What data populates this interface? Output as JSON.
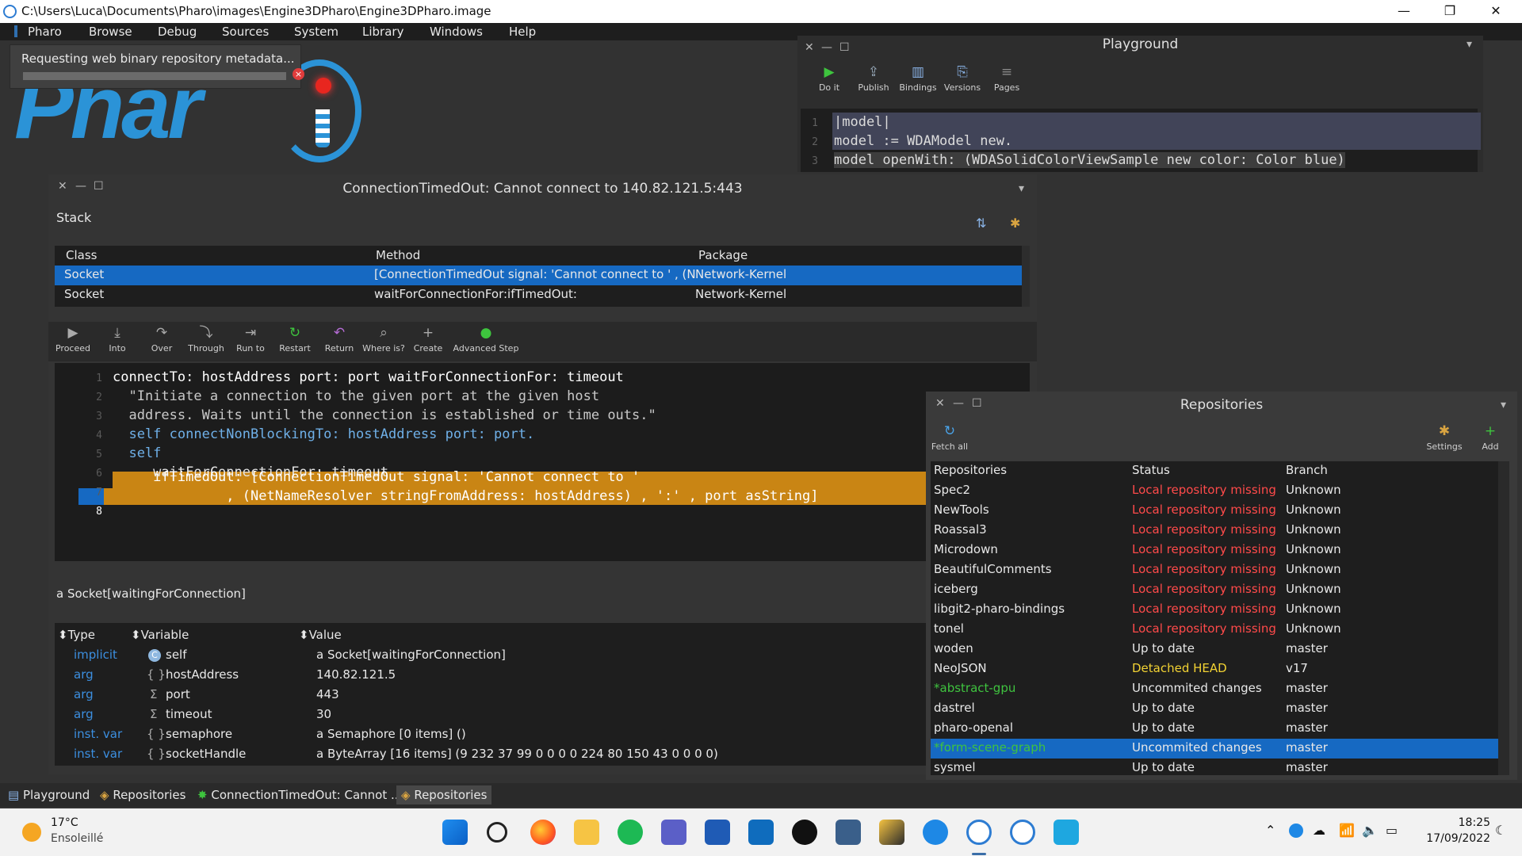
{
  "os_title": "C:\\Users\\Luca\\Documents\\Pharo\\images\\Engine3DPharo\\Engine3DPharo.image",
  "window_controls": {
    "minimize": "—",
    "restore": "❐",
    "close": "✕"
  },
  "menu": [
    "Pharo",
    "Browse",
    "Debug",
    "Sources",
    "System",
    "Library",
    "Windows",
    "Help"
  ],
  "logo_text": "Phar",
  "progress": {
    "label": "Requesting web binary repository metadata...",
    "cancel": "×"
  },
  "playground": {
    "title": "Playground",
    "toolbar": [
      "Do it",
      "Publish",
      "Bindings",
      "Versions",
      "Pages"
    ],
    "lines": [
      {
        "n": "1",
        "text": "|model|"
      },
      {
        "n": "2",
        "text": "model := WDAModel new."
      },
      {
        "n": "3",
        "text": "model openWith: (WDASolidColorViewSample new color: Color blue)"
      }
    ]
  },
  "debugger": {
    "title": "ConnectionTimedOut: Cannot connect to 140.82.121.5:443",
    "stack_label": "Stack",
    "columns": [
      "Class",
      "Method",
      "Package"
    ],
    "rows": [
      {
        "class": "Socket",
        "method": "[ConnectionTimedOut signal: 'Cannot connect to '   , (NetN",
        "package": "Network-Kernel",
        "selected": true
      },
      {
        "class": "Socket",
        "method": "waitForConnectionFor:ifTimedOut:",
        "package": "Network-Kernel",
        "selected": false
      }
    ],
    "toolbar": [
      "Proceed",
      "Into",
      "Over",
      "Through",
      "Run to",
      "Restart",
      "Return",
      "Where is?",
      "Create",
      "Advanced Step"
    ],
    "code_lines": [
      {
        "n": "1",
        "text": "connectTo: hostAddress port: port waitForConnectionFor: timeout"
      },
      {
        "n": "2",
        "text": "  \"Initiate a connection to the given port at the given host"
      },
      {
        "n": "3",
        "text": "  address. Waits until the connection is established or time outs.\""
      },
      {
        "n": "4",
        "text": "  self connectNonBlockingTo: hostAddress port: port."
      },
      {
        "n": "5",
        "text": "  self"
      },
      {
        "n": "6",
        "text": "     waitForConnectionFor: timeout"
      },
      {
        "n": "7",
        "text": "     ifTimedOut: [ConnectionTimedOut signal: 'Cannot connect to '"
      },
      {
        "n": "8",
        "text": "              , (NetNameResolver stringFromAddress: hostAddress) , ':' , port asString]"
      }
    ],
    "receiver_label": "a Socket[waitingForConnection]",
    "inspector_columns": [
      "Type",
      "Variable",
      "Value"
    ],
    "inspector_rows": [
      {
        "type": "implicit",
        "icon": "C",
        "variable": "self",
        "value": "a Socket[waitingForConnection]"
      },
      {
        "type": "arg",
        "icon": "{ }",
        "variable": "hostAddress",
        "value": "140.82.121.5"
      },
      {
        "type": "arg",
        "icon": "Σ",
        "variable": "port",
        "value": "443"
      },
      {
        "type": "arg",
        "icon": "Σ",
        "variable": "timeout",
        "value": "30"
      },
      {
        "type": "inst. var",
        "icon": "{ }",
        "variable": "semaphore",
        "value": "a Semaphore [0 items] ()"
      },
      {
        "type": "inst. var",
        "icon": "{ }",
        "variable": "socketHandle",
        "value": "a ByteArray [16 items] (9 232 37 99 0 0 0 0 224 80 150 43 0 0 0 0)"
      }
    ]
  },
  "repositories": {
    "title": "Repositories",
    "toolbar": {
      "fetch_all": "Fetch all",
      "settings": "Settings",
      "add": "Add"
    },
    "columns": [
      "Repositories",
      "Status",
      "Branch"
    ],
    "rows": [
      {
        "name": "Spec2",
        "status": "Local repository missing",
        "branch": "Unknown",
        "kind": "missing"
      },
      {
        "name": "NewTools",
        "status": "Local repository missing",
        "branch": "Unknown",
        "kind": "missing"
      },
      {
        "name": "Roassal3",
        "status": "Local repository missing",
        "branch": "Unknown",
        "kind": "missing"
      },
      {
        "name": "Microdown",
        "status": "Local repository missing",
        "branch": "Unknown",
        "kind": "missing"
      },
      {
        "name": "BeautifulComments",
        "status": "Local repository missing",
        "branch": "Unknown",
        "kind": "missing"
      },
      {
        "name": "iceberg",
        "status": "Local repository missing",
        "branch": "Unknown",
        "kind": "missing"
      },
      {
        "name": "libgit2-pharo-bindings",
        "status": "Local repository missing",
        "branch": "Unknown",
        "kind": "missing"
      },
      {
        "name": "tonel",
        "status": "Local repository missing",
        "branch": "Unknown",
        "kind": "missing"
      },
      {
        "name": "woden",
        "status": "Up to date",
        "branch": "master",
        "kind": "ok"
      },
      {
        "name": "NeoJSON",
        "status": "Detached HEAD",
        "branch": "v17",
        "kind": "detached"
      },
      {
        "name": "*abstract-gpu",
        "status": "Uncommited changes",
        "branch": "master",
        "kind": "dirty"
      },
      {
        "name": "dastrel",
        "status": "Up to date",
        "branch": "master",
        "kind": "ok"
      },
      {
        "name": "pharo-openal",
        "status": "Up to date",
        "branch": "master",
        "kind": "ok"
      },
      {
        "name": "*form-scene-graph",
        "status": "Uncommited changes",
        "branch": "master",
        "kind": "dirty-selected"
      },
      {
        "name": "sysmel",
        "status": "Up to date",
        "branch": "master",
        "kind": "ok"
      }
    ]
  },
  "pharo_taskbar": [
    "Playground",
    "Repositories",
    "ConnectionTimedOut: Cannot ...",
    "Repositories"
  ],
  "windows_taskbar": {
    "weather_temp": "17°C",
    "weather_desc": "Ensoleillé",
    "time": "18:25",
    "date": "17/09/2022"
  },
  "colors": {
    "selection": "#1669c2",
    "missing": "#ff4a4a",
    "detached": "#f2d233",
    "dirty_name": "#3fc33f",
    "type_blue": "#3c8fe0",
    "highlight": "#c98514"
  }
}
